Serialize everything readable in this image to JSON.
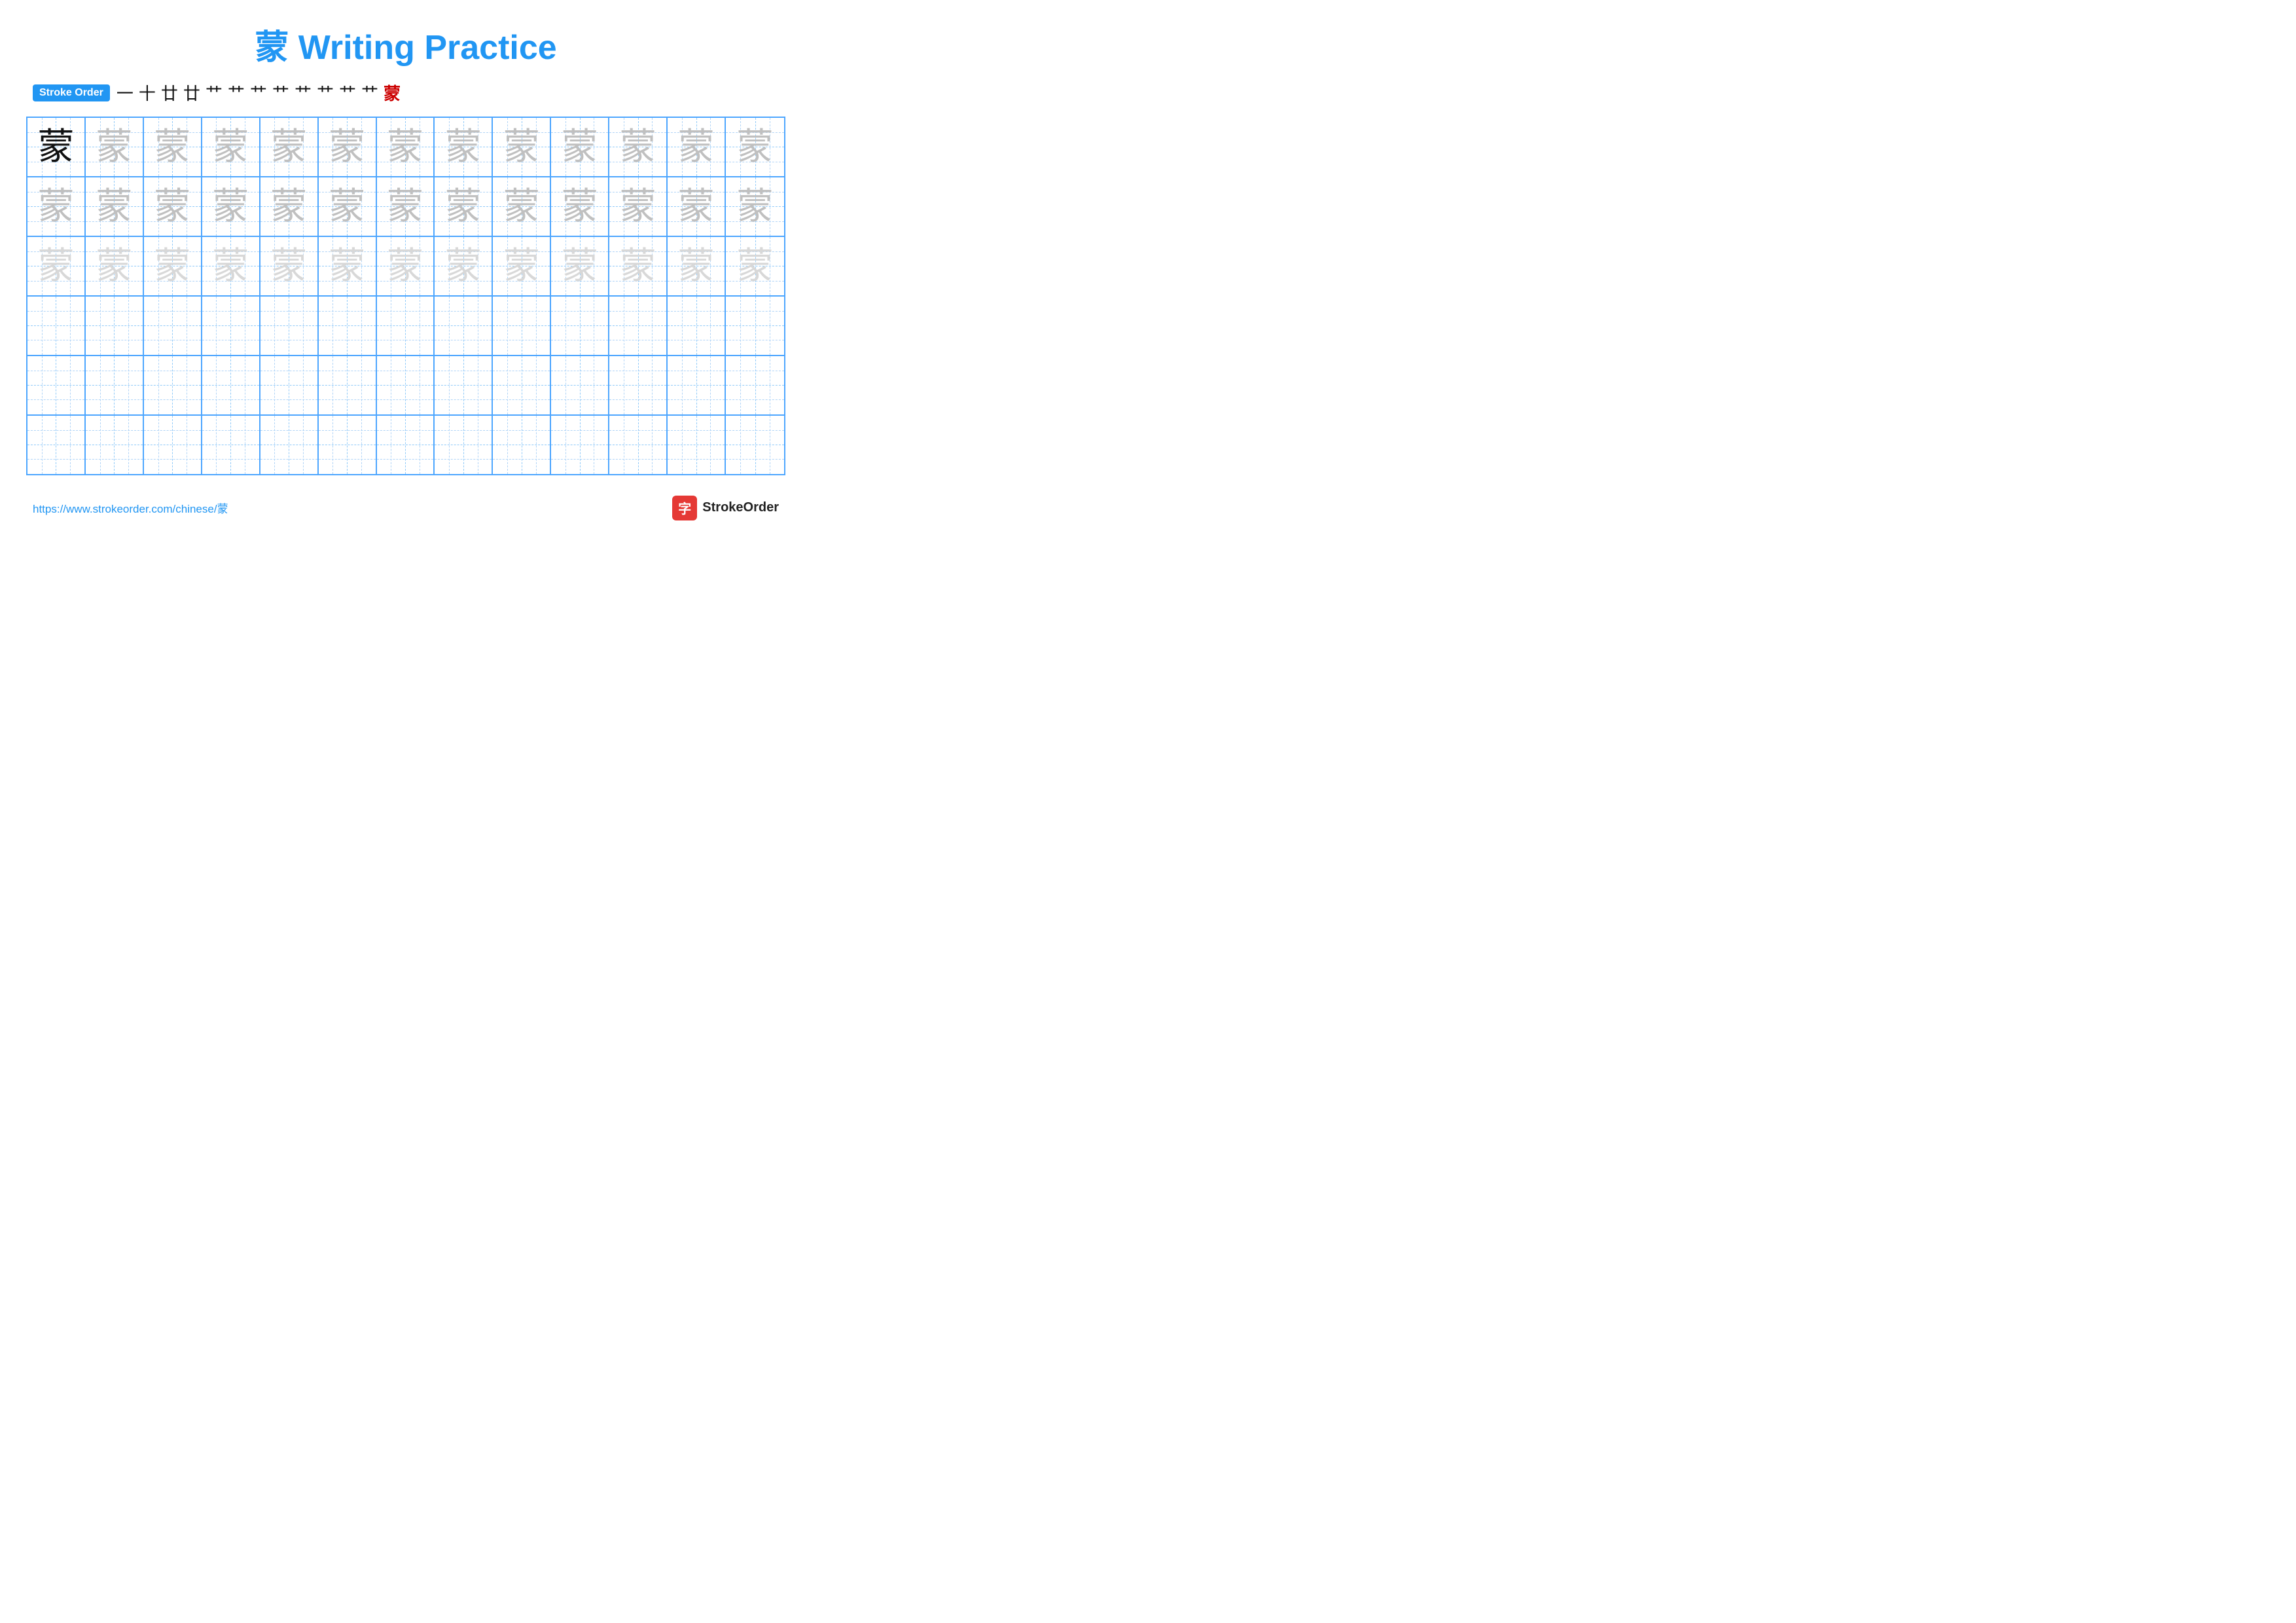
{
  "title": "蒙 Writing Practice",
  "stroke_order": {
    "label": "Stroke Order",
    "chars": [
      "一",
      "十",
      "廿",
      "廿",
      "艹",
      "艹",
      "艹",
      "艹",
      "艹",
      "艹",
      "艹",
      "艹",
      "蒙"
    ],
    "last_red": true
  },
  "character": "蒙",
  "grid": {
    "cols": 13,
    "rows": 6
  },
  "footer": {
    "url": "https://www.strokeorder.com/chinese/蒙",
    "logo_text": "StrokeOrder",
    "logo_icon": "字"
  }
}
